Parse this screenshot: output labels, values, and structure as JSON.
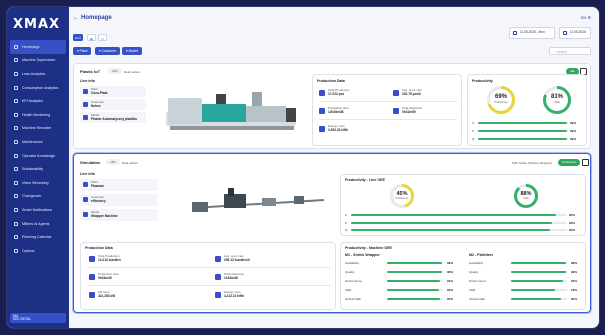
{
  "app": {
    "logo": "XMAX"
  },
  "sidebar": {
    "items": [
      {
        "label": "Homepage",
        "icon": "home-icon",
        "active": true
      },
      {
        "label": "Machine Supervision",
        "icon": "monitor-icon"
      },
      {
        "label": "Lean Analytics",
        "icon": "chart-icon"
      },
      {
        "label": "Consumption Analytics",
        "icon": "bolt-icon"
      },
      {
        "label": "KPI Analytics",
        "icon": "kpi-icon"
      },
      {
        "label": "Health Monitoring",
        "icon": "heart-icon"
      },
      {
        "label": "Machine Recorder",
        "icon": "record-icon"
      },
      {
        "label": "Maintenance",
        "icon": "wrench-icon"
      },
      {
        "label": "Operator Knowledge",
        "icon": "book-icon"
      },
      {
        "label": "Sustainability",
        "icon": "leaf-icon"
      },
      {
        "label": "Video Streaming",
        "icon": "video-icon"
      },
      {
        "label": "Changeover",
        "icon": "swap-icon"
      },
      {
        "label": "Smart Notifications",
        "icon": "bell-icon"
      },
      {
        "label": "MBees AI Agents",
        "icon": "bee-icon"
      },
      {
        "label": "Planning Calendar",
        "icon": "calendar-icon"
      },
      {
        "label": "Options",
        "icon": "gear-icon"
      }
    ],
    "user": {
      "line1": "Moi",
      "line2": "SEE DETAIL"
    }
  },
  "header": {
    "back": "←",
    "title": "Homepage",
    "lang": "EN ⚙"
  },
  "dates": {
    "from": "11.05.2025 - Mon",
    "to": "11.05.2025"
  },
  "view": {
    "grid": "Grid",
    "list": "List"
  },
  "filters": {
    "plant": "Plant",
    "customer": "Customer",
    "model": "Model"
  },
  "search": {
    "placeholder": "Search..."
  },
  "card1": {
    "title": "Plastic IoT",
    "toggle": "OFF",
    "toggle_label": "Real Labels",
    "status": "Idle",
    "line_info": {
      "title": "Line Info",
      "items": [
        {
          "label": "Plant",
          "value": "Coca-Plast"
        },
        {
          "label": "Customer",
          "value": "Nehes"
        },
        {
          "label": "Model",
          "value": "Plaster Automatyczny plastiku"
        }
      ]
    },
    "production_data": {
      "title": "Production Data",
      "items": [
        {
          "label": "Total Production",
          "value": "17.222 pcs"
        },
        {
          "label": "Avg. prod. rate",
          "value": "232.75 pcs/h"
        },
        {
          "label": "Production time",
          "value": "12h28m38"
        },
        {
          "label": "Total downtime",
          "value": "0h31m59"
        },
        {
          "label": "Energy cons.",
          "value": "3,453.23 kWh"
        }
      ]
    },
    "productivity": {
      "title": "Productivity",
      "gauges": [
        {
          "value": "69%",
          "label": "Productivity",
          "pct": 69,
          "color": "#e9d43c"
        },
        {
          "value": "81%",
          "label": "OEE",
          "pct": 81,
          "color": "#35b06a"
        }
      ],
      "bars": [
        {
          "label": "A",
          "value": "99%",
          "pct": 99
        },
        {
          "label": "P",
          "value": "99%",
          "pct": 99
        },
        {
          "label": "Q",
          "value": "99%",
          "pct": 99
        }
      ]
    }
  },
  "card2": {
    "title": "Simulation",
    "toggle": "OFF",
    "toggle_label": "Real Labels",
    "sim_label": "SIM: Stride (Plastics Wrapper)",
    "status": "Production",
    "line_info": {
      "title": "Line Info",
      "items": [
        {
          "label": "Plant",
          "value": "Plasmax"
        },
        {
          "label": "Customer",
          "value": "efficiency"
        },
        {
          "label": "Model",
          "value": "Wrapper Machine"
        }
      ]
    },
    "productivity": {
      "title": "Productivity - Line OEE",
      "gauges": [
        {
          "value": "45%",
          "label": "Productivity",
          "pct": 45,
          "color": "#e9d43c"
        },
        {
          "value": "88%",
          "label": "OEE",
          "pct": 88,
          "color": "#35b06a"
        }
      ],
      "bars": [
        {
          "label": "A",
          "value": "95%",
          "pct": 95
        },
        {
          "label": "P",
          "value": "93%",
          "pct": 93
        },
        {
          "label": "Q",
          "value": "92%",
          "pct": 92
        }
      ]
    },
    "production_data": {
      "title": "Production Data",
      "items": [
        {
          "label": "Total Production",
          "value": "12,212 bundles"
        },
        {
          "label": "Avg. prod. rate",
          "value": "259.12 bundles/h"
        },
        {
          "label": "Production time",
          "value": "9h24m49"
        },
        {
          "label": "Total downtime",
          "value": "1h22m48"
        },
        {
          "label": "kW cons.",
          "value": "421,283 kW"
        },
        {
          "label": "Energy cons.",
          "value": "4,212.10 kWh"
        }
      ]
    },
    "machine_oee": {
      "title": "Productivity - Machine OEE",
      "machines": [
        {
          "title": "M1 - Shrink Wrapper",
          "rows": [
            {
              "label": "Availability",
              "value": "99%",
              "pct": 99
            },
            {
              "label": "Quality",
              "value": "98%",
              "pct": 98
            },
            {
              "label": "Performance",
              "value": "94%",
              "pct": 94
            },
            {
              "label": "OEE",
              "value": "93%",
              "pct": 93
            },
            {
              "label": "Global OEE",
              "value": "95%",
              "pct": 95
            }
          ]
        },
        {
          "title": "M2 - Palletizer",
          "rows": [
            {
              "label": "Availability",
              "value": "98%",
              "pct": 98
            },
            {
              "label": "Quality",
              "value": "99%",
              "pct": 99
            },
            {
              "label": "Performance",
              "value": "93%",
              "pct": 93
            },
            {
              "label": "OEE",
              "value": "78%",
              "pct": 78
            },
            {
              "label": "Global OEE",
              "value": "90%",
              "pct": 90
            }
          ]
        }
      ]
    }
  }
}
